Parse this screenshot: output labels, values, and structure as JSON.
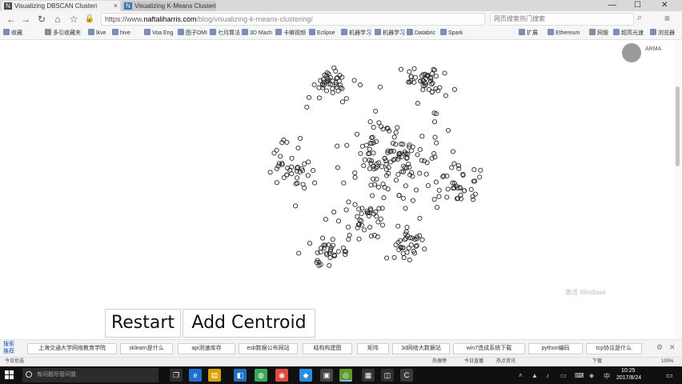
{
  "browser": {
    "tabs": [
      {
        "title": "Visualizing DBSCAN Clusteri",
        "favicon": "N"
      },
      {
        "title": "Visualizing K-Means Clusteri",
        "favicon": "N"
      }
    ],
    "url_scheme": "https://www.",
    "url_host": "naftaliharris.com",
    "url_path": "/blog/visualizing-k-means-clustering/",
    "search_placeholder": "网页搜索热门搜索",
    "bookmarks": [
      "收藏",
      "多引收藏夹",
      "lkve",
      "hive",
      "Voa Eng",
      "图子DMI",
      "七月算法",
      "3D Mach",
      "卡嘛视频",
      "Eclipse",
      "机器学习",
      "机器学习",
      "Databric",
      "Spark",
      "扩展",
      "Ethereum",
      "网银",
      "超高光速",
      "浏览器"
    ]
  },
  "page": {
    "restart_label": "Restart",
    "add_centroid_label": "Add Centroid",
    "user_label": "ARMA",
    "watermark": "激活 Windows"
  },
  "hot_search": {
    "label": "搜索 推荐",
    "items": [
      "上海交通大学网络教育学院",
      "sklearn是什么",
      "api测速库存",
      "esb数据公布网站",
      "结构构建图",
      "矩阵",
      "3d网络大数据站",
      "win7造成系统下载",
      "python编码",
      "tcp协议是什么"
    ]
  },
  "status": {
    "items": [
      "今日优选",
      "热搜榜",
      "今日直播",
      "热点资讯",
      "下载",
      "100%"
    ]
  },
  "taskbar": {
    "search_placeholder": "有问题尽管问我",
    "time": "10:25",
    "date": "2017/8/24"
  },
  "colors": {
    "point_stroke": "#2a2a2a",
    "taskbar": "#101010"
  }
}
